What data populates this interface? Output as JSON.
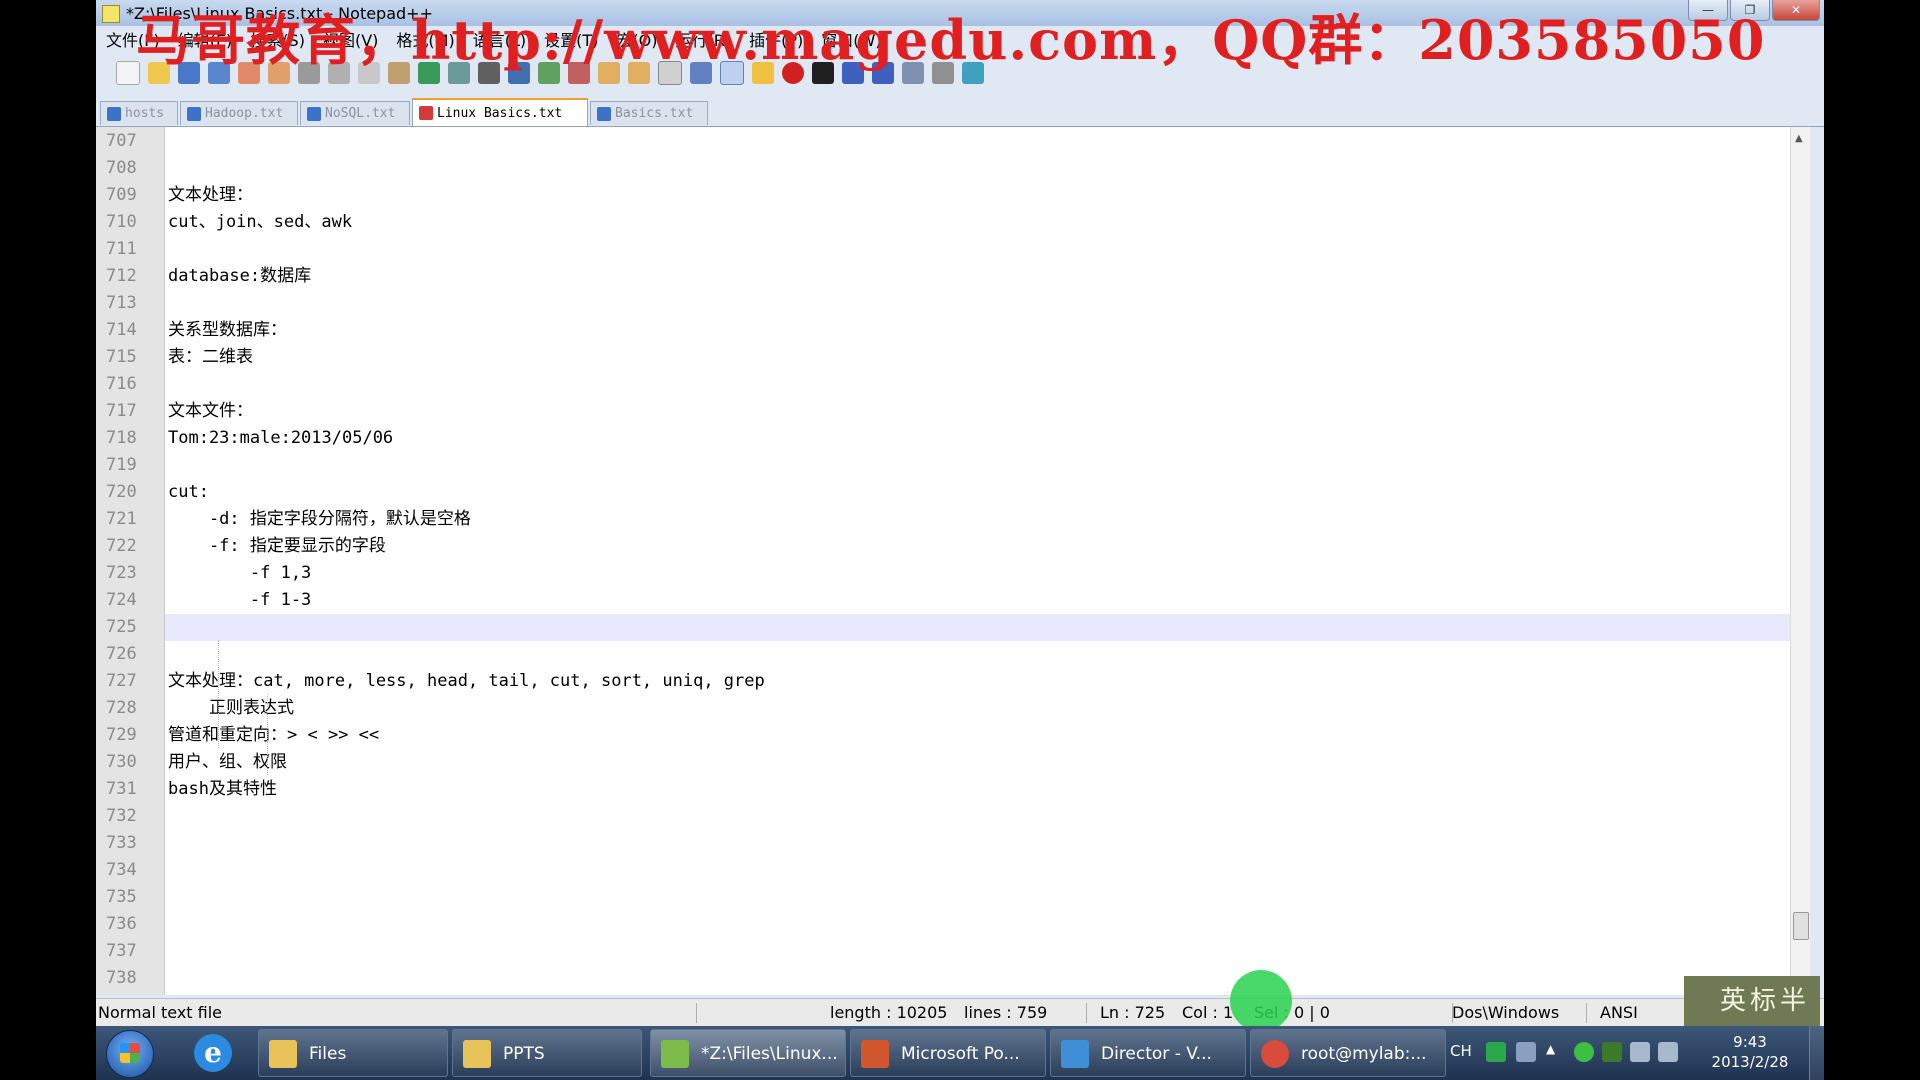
{
  "window": {
    "title": "*Z:\\Files\\Linux Basics.txt - Notepad++",
    "watermark": "马哥教育，http://www.magedu.com，QQ群：203585050",
    "controls": [
      "—",
      "❐",
      "✕"
    ]
  },
  "menu": [
    "文件(F)",
    "编辑(E)",
    "搜索(S)",
    "视图(V)",
    "格式(M)",
    "语言(L)",
    "设置(T)",
    "宏(O)",
    "运行(R)",
    "插件(P)",
    "窗口(W)",
    "?"
  ],
  "tabs": [
    {
      "label": "hosts",
      "active": false
    },
    {
      "label": "Hadoop.txt",
      "active": false
    },
    {
      "label": "NoSQL.txt",
      "active": false
    },
    {
      "label": "Linux Basics.txt",
      "active": true
    },
    {
      "label": "Basics.txt",
      "active": false
    }
  ],
  "editor": {
    "current_line": 725,
    "lines": [
      {
        "n": "707",
        "text": ""
      },
      {
        "n": "708",
        "text": ""
      },
      {
        "n": "709",
        "text": "文本处理："
      },
      {
        "n": "710",
        "text": "cut、join、sed、awk"
      },
      {
        "n": "711",
        "text": ""
      },
      {
        "n": "712",
        "text": "database:数据库"
      },
      {
        "n": "713",
        "text": ""
      },
      {
        "n": "714",
        "text": "关系型数据库："
      },
      {
        "n": "715",
        "text": "表：二维表"
      },
      {
        "n": "716",
        "text": ""
      },
      {
        "n": "717",
        "text": "文本文件："
      },
      {
        "n": "718",
        "text": "Tom:23:male:2013/05/06"
      },
      {
        "n": "719",
        "text": ""
      },
      {
        "n": "720",
        "text": "cut:"
      },
      {
        "n": "721",
        "text": "    -d: 指定字段分隔符，默认是空格"
      },
      {
        "n": "722",
        "text": "    -f: 指定要显示的字段"
      },
      {
        "n": "723",
        "text": "        -f 1,3"
      },
      {
        "n": "724",
        "text": "        -f 1-3"
      },
      {
        "n": "725",
        "text": ""
      },
      {
        "n": "726",
        "text": ""
      },
      {
        "n": "727",
        "text": "文本处理：cat, more, less, head, tail, cut, sort, uniq, grep"
      },
      {
        "n": "728",
        "text": "    正则表达式"
      },
      {
        "n": "729",
        "text": "管道和重定向：> < >> <<"
      },
      {
        "n": "730",
        "text": "用户、组、权限"
      },
      {
        "n": "731",
        "text": "bash及其特性"
      },
      {
        "n": "732",
        "text": ""
      },
      {
        "n": "733",
        "text": ""
      },
      {
        "n": "734",
        "text": ""
      },
      {
        "n": "735",
        "text": ""
      },
      {
        "n": "736",
        "text": ""
      },
      {
        "n": "737",
        "text": ""
      },
      {
        "n": "738",
        "text": ""
      }
    ]
  },
  "status": {
    "file_type": "Normal text file",
    "length": "length : 10205",
    "lines": "lines : 759",
    "ln": "Ln : 725",
    "col": "Col : 1",
    "sel": "Sel : 0 | 0",
    "eol": "Dos\\Windows",
    "encoding": "ANSI",
    "ime": "英标半"
  },
  "taskbar": {
    "tasks": [
      {
        "label": "Files",
        "color": "#e8c35a"
      },
      {
        "label": "PPTS",
        "color": "#e8c35a"
      },
      {
        "label": "*Z:\\Files\\Linux...",
        "color": "#7dbb4a"
      },
      {
        "label": "Microsoft Po...",
        "color": "#d2572f"
      },
      {
        "label": "Director - V...",
        "color": "#3f8fd8"
      },
      {
        "label": "root@mylab:...",
        "color": "#d94b3b"
      }
    ],
    "lang": "CH",
    "time": "9:43",
    "date": "2013/2/28"
  }
}
